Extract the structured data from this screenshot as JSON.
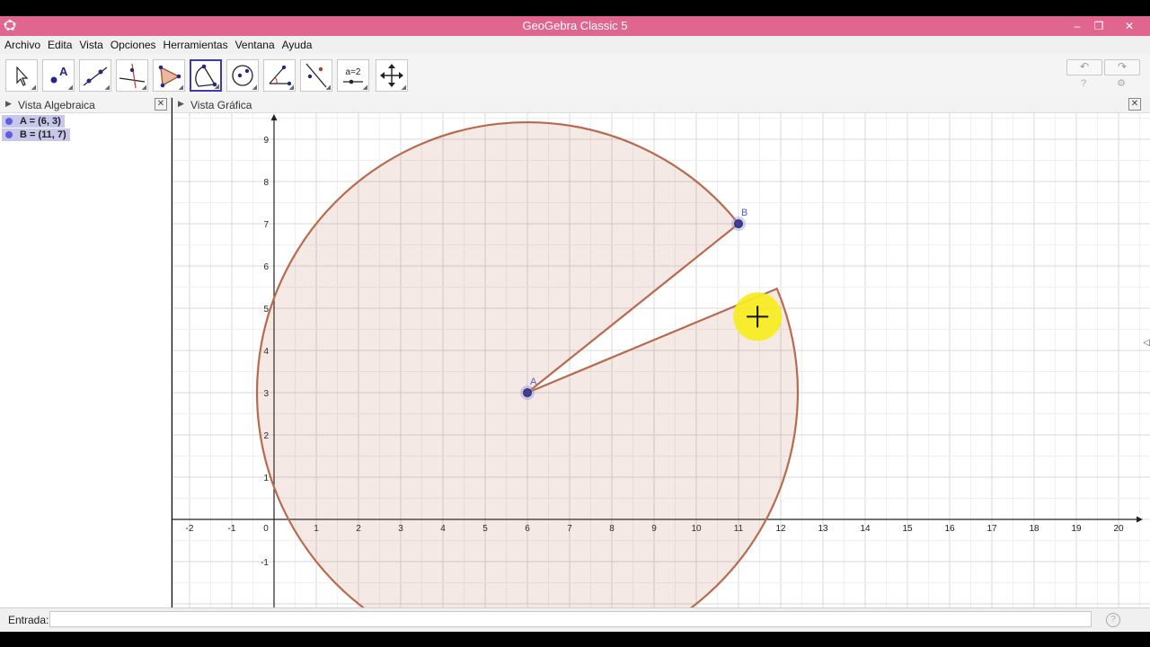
{
  "window": {
    "title": "GeoGebra Classic 5",
    "minimize": "–",
    "restore": "❐",
    "close": "✕"
  },
  "menu": [
    "Archivo",
    "Edita",
    "Vista",
    "Opciones",
    "Herramientas",
    "Ventana",
    "Ayuda"
  ],
  "toolbar": {
    "tools": [
      "move-tool-icon",
      "point-tool-icon",
      "line-tool-icon",
      "perpendicular-tool-icon",
      "polygon-tool-icon",
      "circle-tool-icon",
      "conic-tool-icon",
      "angle-tool-icon",
      "reflect-tool-icon",
      "slider-tool-icon",
      "move-view-tool-icon"
    ],
    "active_index": 5,
    "slider_label": "a=2",
    "point_label": "A",
    "undo": "↶",
    "redo": "↷",
    "help_icon": "?",
    "settings_icon": "⚙"
  },
  "algebra_view": {
    "title": "Vista Algebraica",
    "items": [
      "A = (6, 3)",
      "B = (11, 7)"
    ]
  },
  "graphics_view": {
    "title": "Vista Gráfica",
    "x_ticks": [
      "-2",
      "-1",
      "0",
      "1",
      "2",
      "3",
      "4",
      "5",
      "6",
      "7",
      "8",
      "9",
      "10",
      "11",
      "12",
      "13",
      "14",
      "15",
      "16",
      "17",
      "18",
      "19",
      "20"
    ],
    "y_ticks": [
      "-1",
      "1",
      "2",
      "3",
      "4",
      "5",
      "6",
      "7",
      "8",
      "9"
    ],
    "point_A": {
      "label": "A",
      "x": 6,
      "y": 3
    },
    "point_B": {
      "label": "B",
      "x": 11,
      "y": 7
    },
    "sector_end": {
      "x": 12.0,
      "y": 5.5
    },
    "sector_color": "#b86a4e",
    "point_color": "#3c3ca0",
    "cursor_highlight": "#f7ec1f"
  },
  "input_bar": {
    "label": "Entrada:",
    "help": "?"
  }
}
